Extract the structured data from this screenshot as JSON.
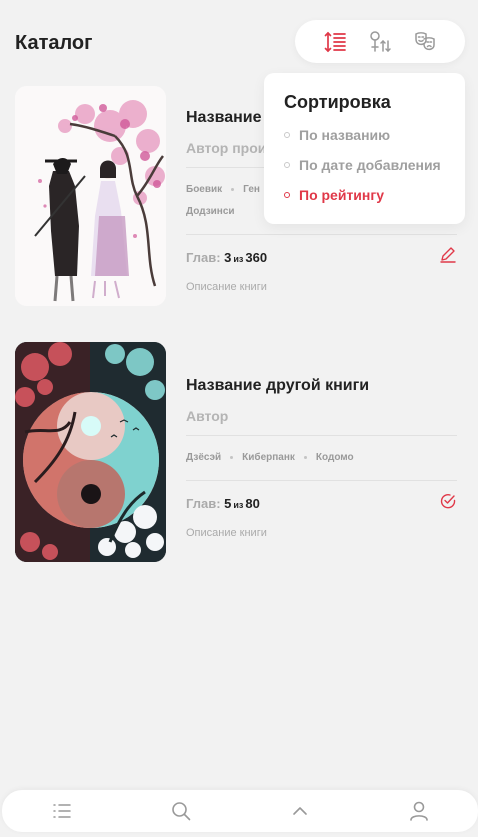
{
  "header": {
    "title": "Каталог"
  },
  "toolbar": {
    "icons": [
      "sort-icon",
      "filter-icon",
      "genres-masks-icon"
    ],
    "accent": "#e03848"
  },
  "sort_menu": {
    "title": "Сортировка",
    "options": [
      {
        "label": "По названию",
        "active": false
      },
      {
        "label": "По дате добавления",
        "active": false
      },
      {
        "label": "По рейтингу",
        "active": true
      }
    ]
  },
  "books": [
    {
      "title": "Название",
      "author": "Автор прои",
      "genres_line1": [
        "Боевик",
        "Ген"
      ],
      "genres_line2": [
        "Додзинси"
      ],
      "chapters_label": "Глав:",
      "current": "3",
      "of": "из",
      "total": "360",
      "description": "Описание книги",
      "status_icon": "edit-pencil-icon"
    },
    {
      "title": "Название другой книги",
      "author": "Автор",
      "genres_line1": [
        "Дзёсэй",
        "Киберпанк",
        "Кодомо"
      ],
      "chapters_label": "Глав:",
      "current": "5",
      "of": "из",
      "total": "80",
      "description": "Описание книги",
      "status_icon": "check-circle-icon"
    }
  ],
  "bottom_nav": {
    "items": [
      "list-icon",
      "search-icon",
      "chevron-up-icon",
      "profile-icon"
    ]
  },
  "colors": {
    "accent": "#e03848",
    "background": "#f2f2f2",
    "muted": "#aaaaaa"
  }
}
